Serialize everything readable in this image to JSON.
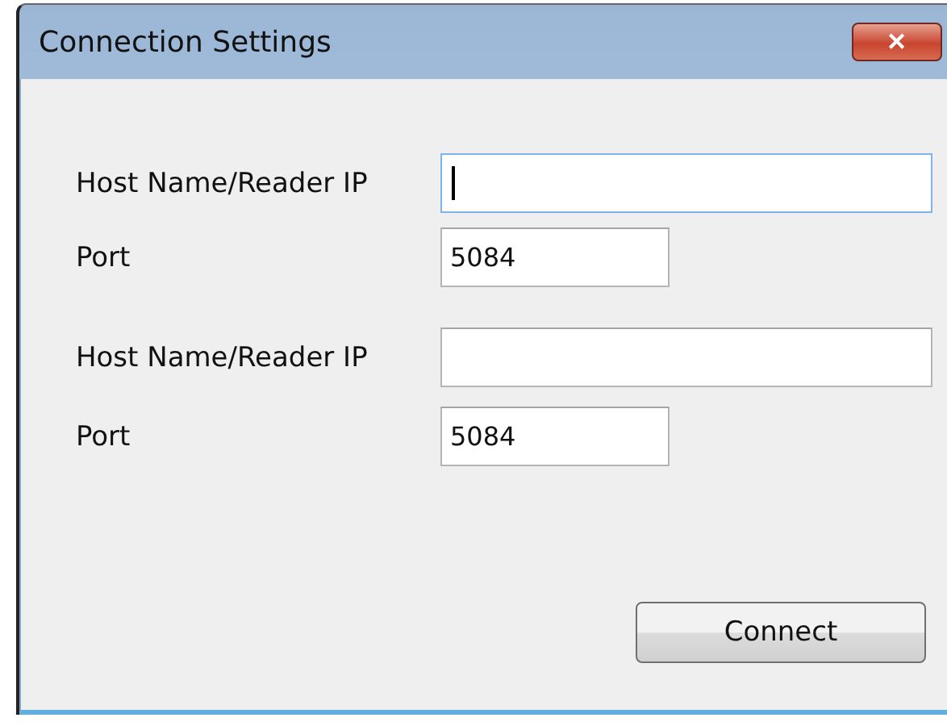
{
  "window": {
    "title": "Connection Settings",
    "close_icon": "✕"
  },
  "fields": [
    {
      "label": "Host Name/Reader IP",
      "focused": true,
      "kind": "wide"
    },
    {
      "label": "Port",
      "value": "5084",
      "focused": false,
      "kind": "narrow"
    },
    {
      "label": "Host Name/Reader IP",
      "focused": false,
      "kind": "wide"
    },
    {
      "label": "Port",
      "value": "5084",
      "focused": false,
      "kind": "narrow"
    }
  ],
  "buttons": [
    "Connect"
  ]
}
